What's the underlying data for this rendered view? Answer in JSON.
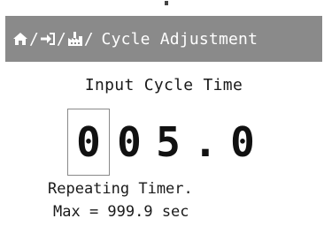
{
  "header": {
    "breadcrumb_icons": [
      "home-icon",
      "login-icon",
      "factory-icon"
    ],
    "separator": "/",
    "title": "Cycle Adjustment"
  },
  "main": {
    "prompt": "Input Cycle Time",
    "digits": [
      "0",
      "0",
      "5",
      ".",
      "0"
    ],
    "active_digit_index": 0,
    "note_line1": "Repeating Timer.",
    "note_line2": "Max = 999.9 sec"
  },
  "colors": {
    "header_bg": "#8a8a8a",
    "header_text": "#ffffff",
    "body_bg": "#ffffff",
    "text": "#111111"
  }
}
